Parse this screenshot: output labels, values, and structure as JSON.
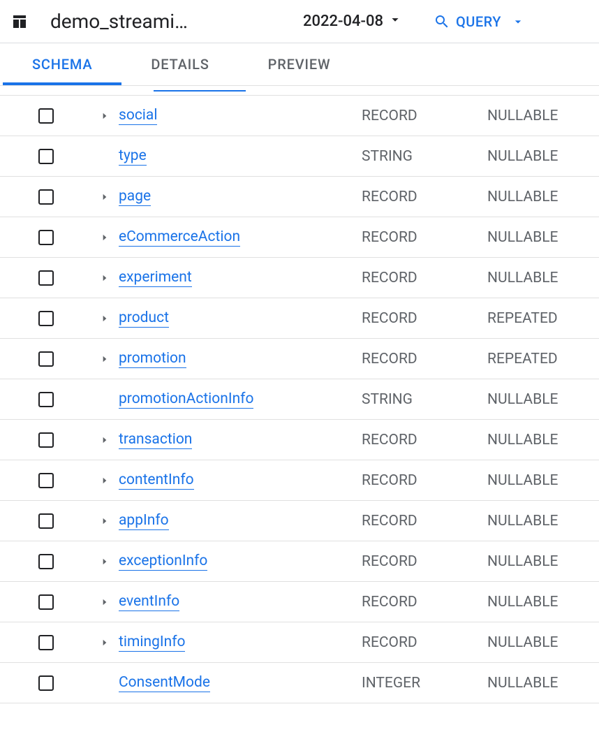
{
  "header": {
    "title": "demo_streami…",
    "partitionDate": "2022-04-08",
    "queryLabel": "QUERY"
  },
  "tabs": [
    {
      "label": "SCHEMA",
      "active": true
    },
    {
      "label": "DETAILS",
      "active": false
    },
    {
      "label": "PREVIEW",
      "active": false
    }
  ],
  "schema": [
    {
      "name": "social",
      "type": "RECORD",
      "mode": "NULLABLE",
      "expandable": true
    },
    {
      "name": "type",
      "type": "STRING",
      "mode": "NULLABLE",
      "expandable": false
    },
    {
      "name": "page",
      "type": "RECORD",
      "mode": "NULLABLE",
      "expandable": true
    },
    {
      "name": "eCommerceAction",
      "type": "RECORD",
      "mode": "NULLABLE",
      "expandable": true
    },
    {
      "name": "experiment",
      "type": "RECORD",
      "mode": "NULLABLE",
      "expandable": true
    },
    {
      "name": "product",
      "type": "RECORD",
      "mode": "REPEATED",
      "expandable": true
    },
    {
      "name": "promotion",
      "type": "RECORD",
      "mode": "REPEATED",
      "expandable": true
    },
    {
      "name": "promotionActionInfo",
      "type": "STRING",
      "mode": "NULLABLE",
      "expandable": false
    },
    {
      "name": "transaction",
      "type": "RECORD",
      "mode": "NULLABLE",
      "expandable": true
    },
    {
      "name": "contentInfo",
      "type": "RECORD",
      "mode": "NULLABLE",
      "expandable": true
    },
    {
      "name": "appInfo",
      "type": "RECORD",
      "mode": "NULLABLE",
      "expandable": true
    },
    {
      "name": "exceptionInfo",
      "type": "RECORD",
      "mode": "NULLABLE",
      "expandable": true
    },
    {
      "name": "eventInfo",
      "type": "RECORD",
      "mode": "NULLABLE",
      "expandable": true
    },
    {
      "name": "timingInfo",
      "type": "RECORD",
      "mode": "NULLABLE",
      "expandable": true
    },
    {
      "name": "ConsentMode",
      "type": "INTEGER",
      "mode": "NULLABLE",
      "expandable": false
    }
  ]
}
